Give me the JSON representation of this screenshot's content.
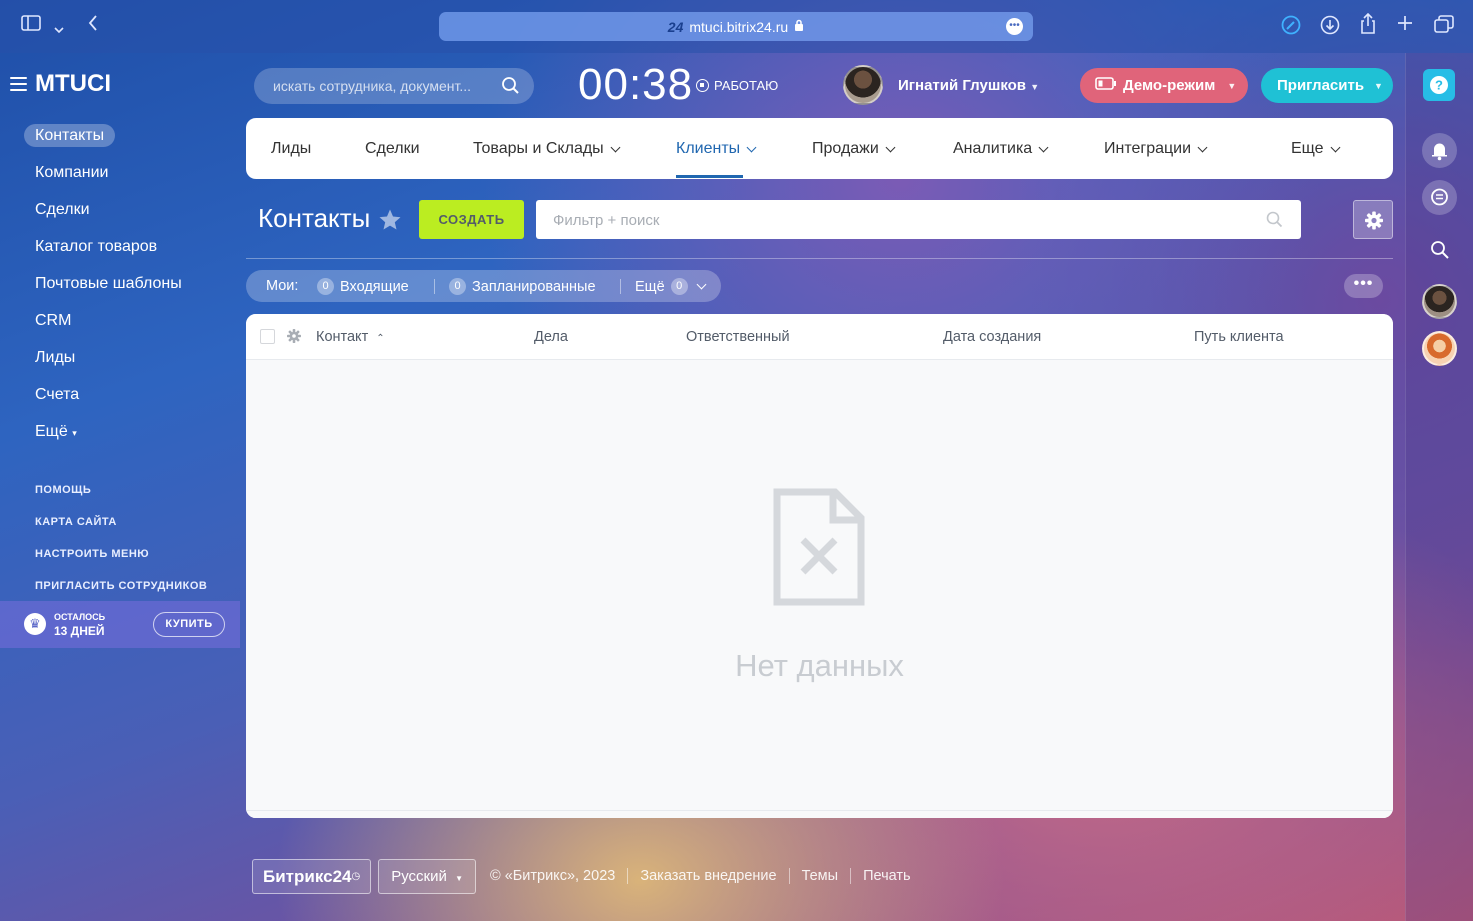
{
  "browser": {
    "url": "mtuci.bitrix24.ru",
    "url_badge": "24"
  },
  "app": {
    "logo": "MTUCI"
  },
  "header": {
    "search_placeholder": "искать сотрудника, документ...",
    "clock": "00:38",
    "work_status": "РАБОТАЮ",
    "user_name": "Игнатий Глушков",
    "demo_label": "Демо-режим",
    "invite_label": "Пригласить"
  },
  "sidebar": {
    "items": [
      {
        "label": "Контакты",
        "active": true
      },
      {
        "label": "Компании"
      },
      {
        "label": "Сделки"
      },
      {
        "label": "Каталог товаров"
      },
      {
        "label": "Почтовые шаблоны"
      },
      {
        "label": "CRM"
      },
      {
        "label": "Лиды"
      },
      {
        "label": "Счета"
      },
      {
        "label": "Ещё"
      }
    ],
    "links": {
      "help": "ПОМОЩЬ",
      "sitemap": "КАРТА САЙТА",
      "configure_menu": "НАСТРОИТЬ МЕНЮ",
      "invite_staff": "ПРИГЛАСИТЬ СОТРУДНИКОВ"
    },
    "trial": {
      "line1": "ОСТАЛОСЬ",
      "line2": "13 ДНЕЙ",
      "buy_label": "КУПИТЬ"
    }
  },
  "top_menu": {
    "items": [
      {
        "label": "Лиды"
      },
      {
        "label": "Сделки"
      },
      {
        "label": "Товары и Склады"
      },
      {
        "label": "Клиенты",
        "active": true
      },
      {
        "label": "Продажи"
      },
      {
        "label": "Аналитика"
      },
      {
        "label": "Интеграции"
      },
      {
        "label": "Еще"
      }
    ]
  },
  "toolbar": {
    "title": "Контакты",
    "create_label": "СОЗДАТЬ",
    "filter_placeholder": "Фильтр + поиск"
  },
  "counters": {
    "prefix": "Мои:",
    "incoming_count": "0",
    "incoming_label": "Входящие",
    "planned_count": "0",
    "planned_label": "Запланированные",
    "more_label": "Ещё",
    "more_count": "0"
  },
  "grid": {
    "columns": [
      "Контакт",
      "Дела",
      "Ответственный",
      "Дата создания",
      "Путь клиента"
    ],
    "empty_text": "Нет данных"
  },
  "footer": {
    "brand": "Битрикс24",
    "language": "Русский",
    "copyright": "© «Битрикс», 2023",
    "order_link": "Заказать внедрение",
    "themes_link": "Темы",
    "print_link": "Печать"
  },
  "colors": {
    "accent": "#2067b0",
    "create_button": "#bbed21",
    "demo_button": "#e0647a",
    "invite_button": "#1fc1d5"
  }
}
